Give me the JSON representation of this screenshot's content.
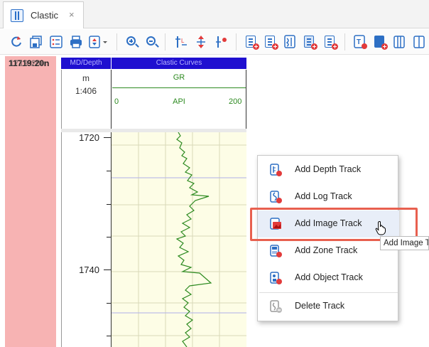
{
  "tab": {
    "title": "Clastic",
    "close": "×"
  },
  "toolbar": {
    "buttons": [
      "refresh-icon",
      "save-all-icon",
      "list-icon",
      "print-icon",
      "sort-dropdown-icon",
      "zoom-in-icon",
      "zoom-out-icon",
      "track-format-icon",
      "track-scale-icon",
      "track-settings-icon",
      "add-depth-track-icon",
      "add-log-track-icon",
      "add-image-track-icon",
      "add-zone-track-icon",
      "add-object-track-icon",
      "add-text-track-icon",
      "add-track-icon",
      "track-panel-icon",
      "track-panel-alt-icon"
    ]
  },
  "left_track": {
    "label": "11719:20n",
    "ghost": "1719:20n"
  },
  "depth_track": {
    "header": "MD/Depth",
    "unit": "m",
    "scale": "1:406"
  },
  "gr_track": {
    "header": "Clastic Curves",
    "curve": "GR",
    "min": "0",
    "unit": "API",
    "max": "200"
  },
  "depth_labels": [
    "1720",
    "1740"
  ],
  "menu": {
    "items": [
      {
        "label": "Add Depth Track",
        "icon": "depth-track-icon"
      },
      {
        "label": "Add Log Track",
        "icon": "log-track-icon"
      },
      {
        "label": "Add Image Track",
        "icon": "image-track-icon"
      },
      {
        "label": "Add Zone Track",
        "icon": "zone-track-icon"
      },
      {
        "label": "Add Object Track",
        "icon": "object-track-icon"
      },
      {
        "label": "Delete Track",
        "icon": "delete-track-icon"
      }
    ],
    "tooltip": "Add Image Track"
  },
  "colors": {
    "accent": "#2d6fc4",
    "curve": "#2d8a20",
    "highlight": "#e8604f",
    "header": "#1f0fd0"
  }
}
